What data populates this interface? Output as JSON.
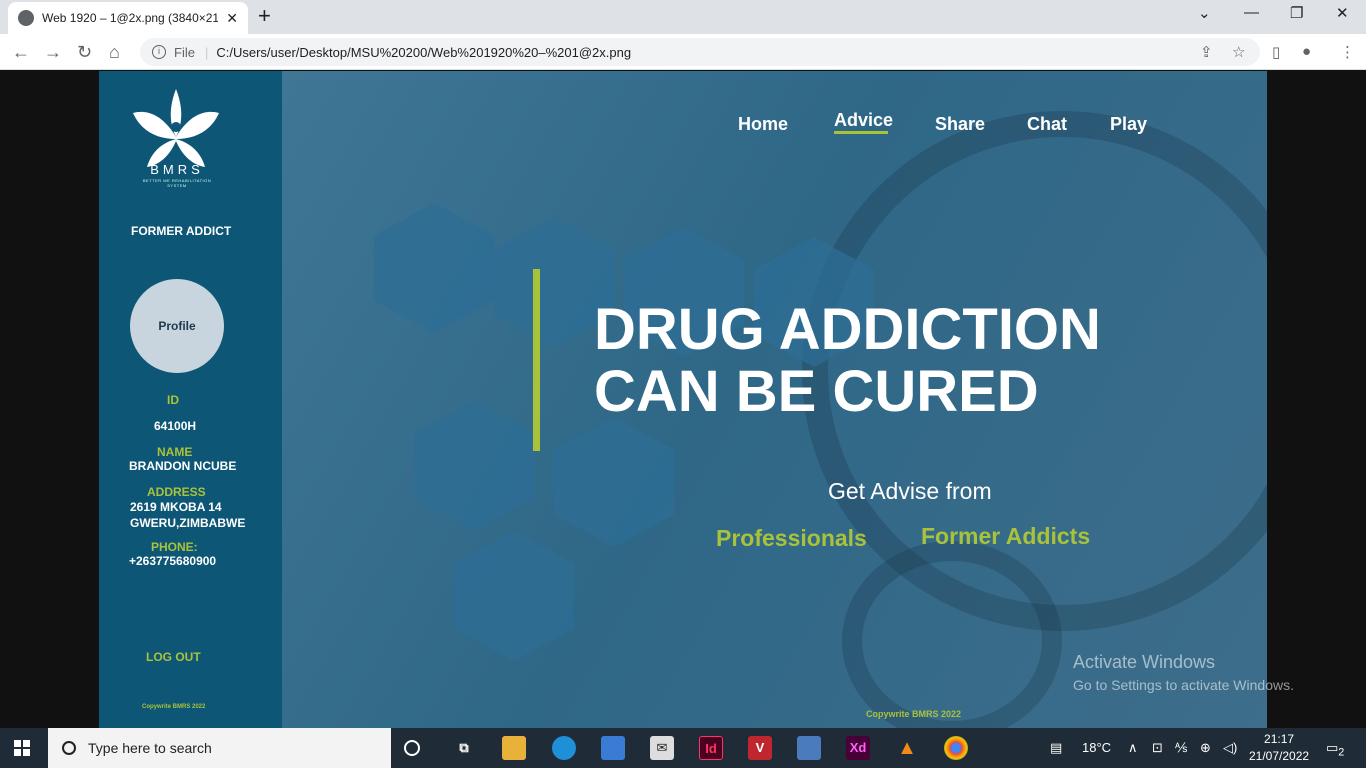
{
  "browser": {
    "tab_title": "Web 1920 – 1@2x.png (3840×21",
    "file_label": "File",
    "url": "C:/Users/user/Desktop/MSU%20200/Web%201920%20–%201@2x.png"
  },
  "sidebar": {
    "logo_text": "BMRS",
    "logo_subtitle": "BETTER ME REHABILITATION SYSTEM",
    "role": "FORMER ADDICT",
    "profile_label": "Profile",
    "id_label": "ID",
    "id_value": "64100H",
    "name_label": "NAME",
    "name_value": "BRANDON NCUBE",
    "address_label": "ADDRESS",
    "address_line1": "2619 MKOBA 14",
    "address_line2": "GWERU,ZIMBABWE",
    "phone_label": "PHONE:",
    "phone_value": "+263775680900",
    "logout": "LOG OUT",
    "copyright": "Copywrite BMRS 2022"
  },
  "nav": {
    "items": [
      "Home",
      "Advice",
      "Share",
      "Chat",
      "Play"
    ],
    "active": "Advice"
  },
  "hero": {
    "headline_line1": "DRUG ADDICTION",
    "headline_line2": "CAN BE CURED",
    "subtitle": "Get Advise from",
    "option1": "Professionals",
    "option2": "Former Addicts",
    "copyright": "Copywrite BMRS 2022"
  },
  "watermark": {
    "line1": "Activate Windows",
    "line2": "Go to Settings to activate Windows."
  },
  "taskbar": {
    "search_placeholder": "Type here to search",
    "temperature": "18°C",
    "time": "21:17",
    "date": "21/07/2022",
    "notification_count": "2"
  },
  "colors": {
    "sidebar_bg": "#0e5676",
    "accent": "#a8c23a"
  }
}
